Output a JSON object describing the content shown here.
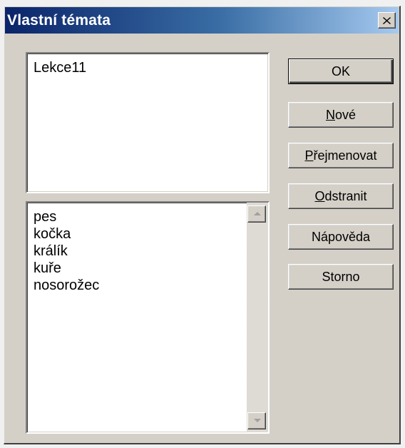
{
  "window": {
    "title": "Vlastní témata",
    "close_glyph": "✕"
  },
  "themes": [
    "Lekce11"
  ],
  "words": [
    "pes",
    "kočka",
    "králík",
    "kuře",
    "nosorožec"
  ],
  "buttons": {
    "ok": "OK",
    "new": {
      "accel": "N",
      "rest": "ové"
    },
    "rename": {
      "accel": "P",
      "rest": "řejmenovat"
    },
    "delete": {
      "accel": "O",
      "rest": "dstranit"
    },
    "help": "Nápověda",
    "cancel": "Storno"
  },
  "icons": {
    "close": "close-icon",
    "scroll_up": "scroll-up-arrow-icon",
    "scroll_down": "scroll-down-arrow-icon"
  },
  "colors": {
    "title_gradient_start": "#0a246a",
    "title_gradient_end": "#a6caf0",
    "dialog_face": "#d4d0c8"
  }
}
